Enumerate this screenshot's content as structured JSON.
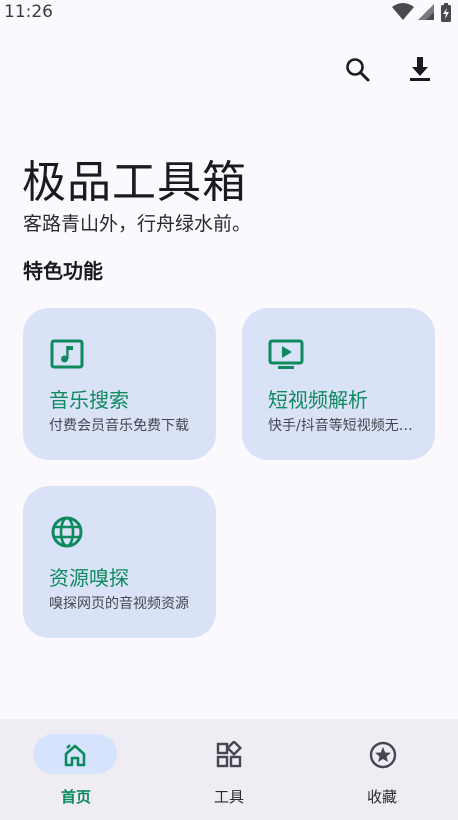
{
  "status_bar": {
    "time": "11:26",
    "icons": [
      "wifi-icon",
      "signal-icon",
      "battery-icon"
    ]
  },
  "top_actions": [
    {
      "name": "search",
      "icon": "search-icon"
    },
    {
      "name": "download",
      "icon": "download-icon"
    }
  ],
  "header": {
    "title": "极品工具箱",
    "subtitle": "客路青山外，行舟绿水前。"
  },
  "section": {
    "title": "特色功能"
  },
  "features": [
    {
      "title": "音乐搜索",
      "desc": "付费会员音乐免费下载",
      "icon": "music-note-icon"
    },
    {
      "title": "短视频解析",
      "desc": "快手/抖音等短视频无水印解析",
      "icon": "video-play-icon"
    },
    {
      "title": "资源嗅探",
      "desc": "嗅探网页的音视频资源",
      "icon": "globe-icon"
    }
  ],
  "bottom_nav": {
    "items": [
      {
        "label": "首页",
        "icon": "home-icon",
        "active": true
      },
      {
        "label": "工具",
        "icon": "apps-icon",
        "active": false
      },
      {
        "label": "收藏",
        "icon": "star-icon",
        "active": false
      }
    ]
  },
  "colors": {
    "background": "#fcf9fe",
    "card": "#dae2f7",
    "accent": "#0e8a5f",
    "nav_background": "#f0ecf4",
    "nav_active_pill": "#d5e3fc"
  }
}
